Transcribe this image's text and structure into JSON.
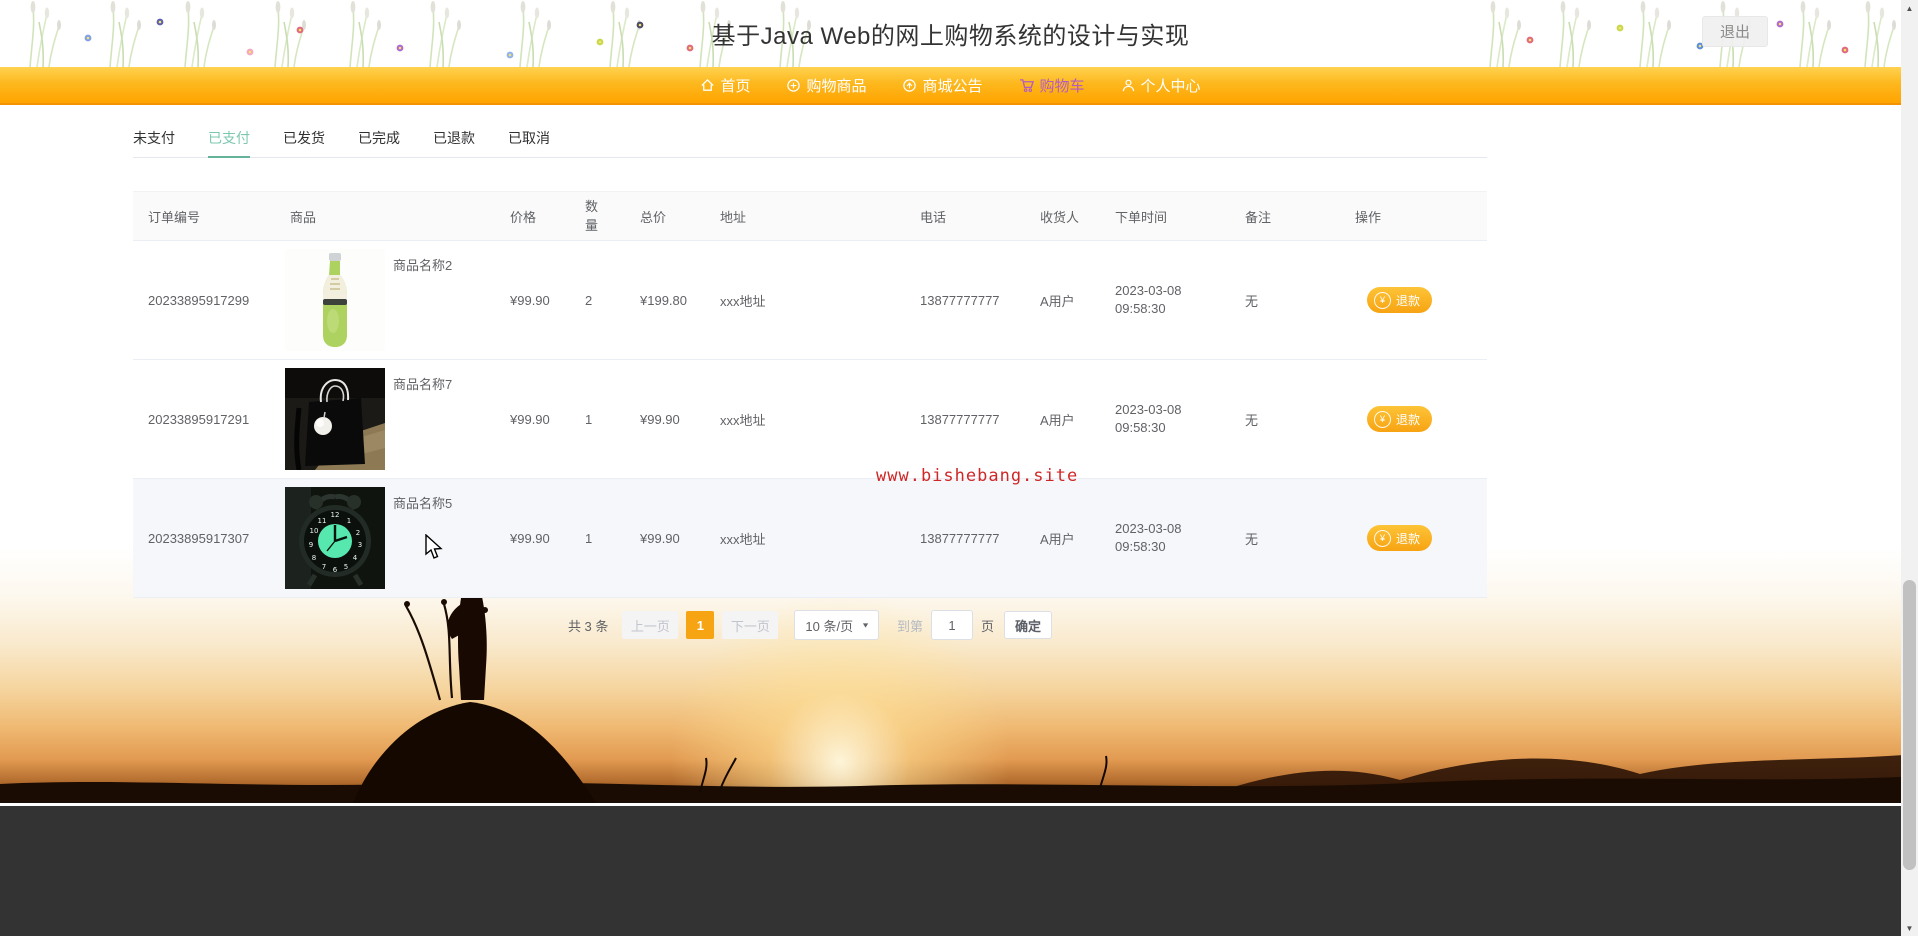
{
  "page": {
    "title": "基于Java Web的网上购物系统的设计与实现",
    "logout_label": "退出",
    "watermark": "www.bishebang.site"
  },
  "nav": {
    "items": [
      {
        "label": "首页",
        "icon": "home-icon"
      },
      {
        "label": "购物商品",
        "icon": "goods-icon"
      },
      {
        "label": "商城公告",
        "icon": "announcement-icon"
      },
      {
        "label": "购物车",
        "icon": "cart-icon",
        "active": true
      },
      {
        "label": "个人中心",
        "icon": "user-icon"
      }
    ]
  },
  "tabs": [
    {
      "label": "未支付",
      "active": false
    },
    {
      "label": "已支付",
      "active": true
    },
    {
      "label": "已发货",
      "active": false
    },
    {
      "label": "已完成",
      "active": false
    },
    {
      "label": "已退款",
      "active": false
    },
    {
      "label": "已取消",
      "active": false
    }
  ],
  "table": {
    "headers": [
      "订单编号",
      "商品",
      "价格",
      "数量",
      "总价",
      "地址",
      "电话",
      "收货人",
      "下单时间",
      "备注",
      "操作"
    ],
    "action_label": "退款",
    "rows": [
      {
        "order_no": "20233895917299",
        "product_name": "商品名称2",
        "product_image": "green-bottle-photo",
        "price": "¥99.90",
        "qty": "2",
        "total": "¥199.80",
        "address": "xxx地址",
        "phone": "13877777777",
        "consignee": "A用户",
        "time_date": "2023-03-08",
        "time_clock": "09:58:30",
        "note": "无"
      },
      {
        "order_no": "20233895917291",
        "product_name": "商品名称7",
        "product_image": "black-handbag-photo",
        "price": "¥99.90",
        "qty": "1",
        "total": "¥99.90",
        "address": "xxx地址",
        "phone": "13877777777",
        "consignee": "A用户",
        "time_date": "2023-03-08",
        "time_clock": "09:58:30",
        "note": "无"
      },
      {
        "order_no": "20233895917307",
        "product_name": "商品名称5",
        "product_image": "alarm-clock-photo",
        "price": "¥99.90",
        "qty": "1",
        "total": "¥99.90",
        "address": "xxx地址",
        "phone": "13877777777",
        "consignee": "A用户",
        "time_date": "2023-03-08",
        "time_clock": "09:58:30",
        "note": "无"
      }
    ]
  },
  "pagination": {
    "total_text": "共 3 条",
    "prev_label": "上一页",
    "current_page": "1",
    "next_label": "下一页",
    "page_size_label": "10 条/页",
    "jump_prefix": "到第",
    "jump_value": "1",
    "jump_suffix": "页",
    "confirm_label": "确定"
  },
  "icons": {
    "dropdown_chevron": "▼",
    "yen_symbol": "¥",
    "scroll_up": "▲",
    "scroll_down": "▼"
  },
  "colors": {
    "navbar_top": "#ffd24f",
    "navbar_bottom": "#ffa400",
    "nav_active": "#b35bc4",
    "tab_active": "#7cc7b0",
    "accent_amber": "#f7a412",
    "watermark_red": "#cf2727",
    "footer_bg": "#333333"
  }
}
